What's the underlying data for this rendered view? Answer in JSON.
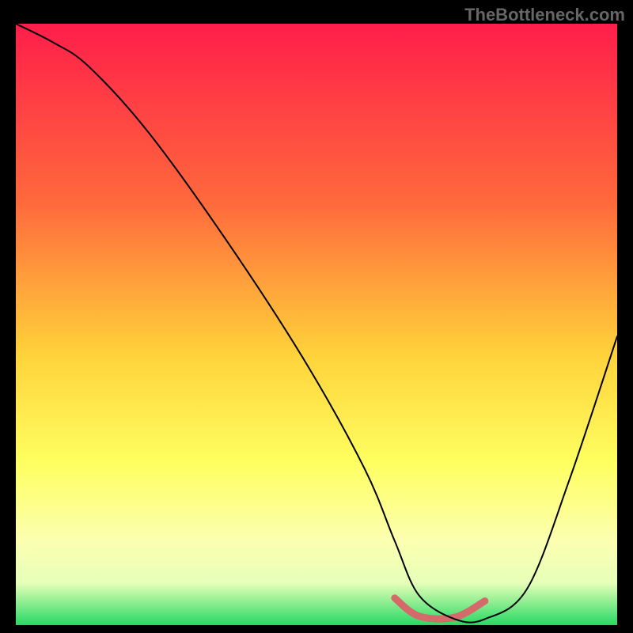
{
  "branding": {
    "watermark": "TheBottleneck.com"
  },
  "chart_data": {
    "type": "line",
    "title": "",
    "xlabel": "",
    "ylabel": "",
    "xlim": [
      0,
      100
    ],
    "ylim": [
      0,
      100
    ],
    "gradient_stops": [
      {
        "offset": 0,
        "color": "#ff1e4a"
      },
      {
        "offset": 30,
        "color": "#ff6a3c"
      },
      {
        "offset": 55,
        "color": "#ffd23a"
      },
      {
        "offset": 73,
        "color": "#feff60"
      },
      {
        "offset": 86,
        "color": "#fcffb0"
      },
      {
        "offset": 93,
        "color": "#e6ffb8"
      },
      {
        "offset": 100,
        "color": "#27d964"
      }
    ],
    "series": [
      {
        "name": "bottleneck-curve",
        "x": [
          0,
          6,
          12,
          22,
          35,
          48,
          58,
          63,
          67,
          73,
          78,
          85,
          92,
          100
        ],
        "y": [
          100,
          97,
          93,
          82,
          64,
          44,
          26,
          14,
          5,
          1,
          1,
          6,
          24,
          48
        ],
        "stroke": "#000000",
        "stroke_width": 2
      }
    ],
    "highlight_band": {
      "color": "#d46a6a",
      "stroke_width": 9,
      "x": [
        63,
        67,
        73,
        78
      ],
      "y": [
        4.5,
        1.5,
        1.3,
        4
      ]
    }
  }
}
